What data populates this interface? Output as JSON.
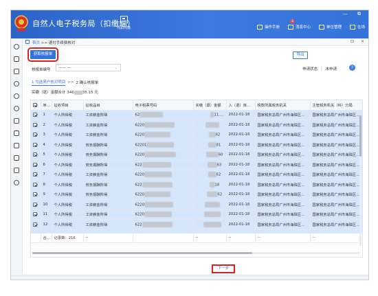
{
  "app": {
    "title": "自然人电子税务局（扣缴端）",
    "proxy_label": "代扣代缴",
    "window_controls": "— ⧉"
  },
  "top_nav": [
    {
      "icon": "report-icon",
      "label": "操作手册"
    },
    {
      "icon": "message-icon",
      "label": "消息中心",
      "badge": "3"
    },
    {
      "icon": "unit-icon",
      "label": "单位管理"
    },
    {
      "icon": "exit-icon",
      "label": "在线"
    }
  ],
  "breadcrumb": {
    "home": "首页",
    "sep": ">>",
    "current": "退付手续费核对"
  },
  "tab_controls": "⊡ ✕",
  "toolbar": {
    "get_button": "获取核报单",
    "export_button": "导出"
  },
  "form": {
    "label": "核报单编号",
    "select_value": "—— —"
  },
  "status": {
    "declared": "申请状态",
    "sep": "|",
    "pending": "未申请"
  },
  "steps": {
    "step1": "1.勾选来户核对项目",
    "arrow": ">>",
    "step2": "2.确认核报单"
  },
  "total": {
    "prefix": "实缴（退）金额合计",
    "value_start": "346",
    "value_end": "35.15 元"
  },
  "table": {
    "headers": [
      "",
      "序号",
      "征收项目",
      "征收品目",
      "电子税票号码",
      "实缴（退）金额",
      "入（退）库日期",
      "税款所属税务机关",
      "主管税务机关（科）分局"
    ],
    "rows": [
      {
        "no": "1",
        "item": "个人所得税",
        "sub": "工资薪金所得",
        "ticket": "62",
        "amount": "11.72",
        "date": "2022-01-18",
        "org": "国家税务总局广州市海珠区...",
        "branch": "国家税务总局广州市海珠区..."
      },
      {
        "no": "2",
        "item": "个人所得税",
        "sub": "工资薪金所得",
        "ticket": "6220",
        "amount": "0.90",
        "date": "2022-01-18",
        "org": "国家税务总局广州市海珠区...",
        "branch": "国家税务总局广州市海珠区..."
      },
      {
        "no": "3",
        "item": "个人所得税",
        "sub": "工资薪金所得",
        "ticket": "6220",
        "amount": "82",
        "date": "2022-01-18",
        "org": "国家税务总局广州市海珠区...",
        "branch": "国家税务总局广州市海珠区..."
      },
      {
        "no": "4",
        "item": "个人所得税",
        "sub": "劳务报酬所得",
        "ticket": "62201",
        "amount": "81",
        "date": "2022-01-18",
        "org": "国家税务总局广州市海珠区...",
        "branch": "国家税务总局广州市海珠区..."
      },
      {
        "no": "5",
        "item": "个人所得税",
        "sub": "劳务报酬所得",
        "ticket": "6220",
        "amount": "60",
        "date": "2022-01-18",
        "org": "国家税务总局广州市海珠区...",
        "branch": "国家税务总局广州市海珠区..."
      },
      {
        "no": "6",
        "item": "个人所得税",
        "sub": "劳务报酬所得",
        "ticket": "622",
        "amount": "63",
        "date": "2022-01-18",
        "org": "国家税务总局广州市海珠区...",
        "branch": "国家税务总局广州市海珠区..."
      },
      {
        "no": "7",
        "item": "个人所得税",
        "sub": "工资薪金所得",
        "ticket": "6220",
        "amount": "62",
        "date": "2022-01-18",
        "org": "国家税务总局广州市海珠区...",
        "branch": "国家税务总局广州市海珠区..."
      },
      {
        "no": "8",
        "item": "个人所得税",
        "sub": "劳务报酬所得",
        "ticket": "622",
        "amount": "18",
        "date": "2022-01-18",
        "org": "国家税务总局广州市海珠区...",
        "branch": "国家税务总局广州市海珠区..."
      },
      {
        "no": "9",
        "item": "个人所得税",
        "sub": "劳务报酬所得",
        "ticket": "6220",
        "amount": "62",
        "date": "2022-01-18",
        "org": "国家税务总局广州市海珠区...",
        "branch": "国家税务总局广州市海珠区..."
      },
      {
        "no": "10",
        "item": "个人所得税",
        "sub": "工资薪金所得",
        "ticket": "6220",
        "amount": "00",
        "date": "2022-01-18",
        "org": "国家税务总局广州市海珠区...",
        "branch": "国家税务总局广州市海珠区..."
      },
      {
        "no": "11",
        "item": "个人所得税",
        "sub": "工资薪金所得",
        "ticket": "6220",
        "amount": "00",
        "date": "2022-01-18",
        "org": "国家税务总局广州市海珠区...",
        "branch": "国家税务总局广州市海珠区..."
      },
      {
        "no": "12",
        "item": "个人所得税",
        "sub": "工资薪金所得",
        "ticket": "622",
        "amount": "5.97",
        "date": "2022-01-18",
        "org": "国家税务总局广州市海珠区...",
        "branch": "国家税务总局广州市海珠区..."
      }
    ],
    "footer": {
      "label": "合计",
      "count": "记录数：216",
      "dash": "--"
    }
  },
  "next_button": "下一步",
  "colors": {
    "primary": "#3474d8",
    "highlight": "#e02020",
    "row_selected": "#d4e6fb"
  }
}
